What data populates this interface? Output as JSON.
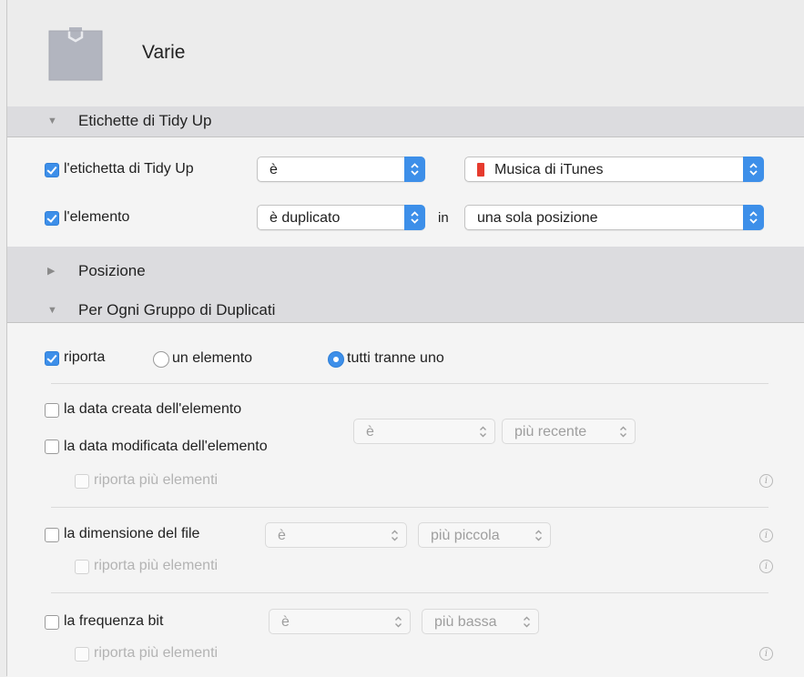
{
  "header": {
    "title": "Varie",
    "icon": "folder-icon"
  },
  "sections": {
    "tags": {
      "label": "Etichette di Tidy Up",
      "expanded": true
    },
    "position": {
      "label": "Posizione",
      "expanded": false
    },
    "per_group": {
      "label": "Per Ogni Gruppo di Duplicati",
      "expanded": true
    }
  },
  "tags_panel": {
    "row1": {
      "checked": true,
      "label": "l'etichetta di Tidy Up",
      "operator": "è",
      "value": "Musica di iTunes",
      "value_color": "#e63b2e"
    },
    "row2": {
      "checked": true,
      "label": "l'elemento",
      "operator": "è duplicato",
      "in_label": "in",
      "value": "una sola posizione"
    }
  },
  "group_panel": {
    "report": {
      "checked": true,
      "label": "riporta",
      "options": [
        "un elemento",
        "tutti tranne uno"
      ],
      "selected": "tutti tranne uno"
    },
    "date_block": {
      "created_label": "la data creata dell'elemento",
      "modified_label": "la data modificata dell'elemento",
      "operator": "è",
      "value": "più recente",
      "report_more": "riporta più elementi"
    },
    "size_block": {
      "label": "la dimensione del file",
      "operator": "è",
      "value": "più piccola",
      "report_more": "riporta più elementi"
    },
    "bitrate_block": {
      "label": "la frequenza bit",
      "operator": "è",
      "value": "più bassa",
      "report_more": "riporta più elementi"
    },
    "info_glyph": "i"
  },
  "colors": {
    "accent": "#3d8fe9",
    "section_bar": "#dcdcdf",
    "panel": "#f4f4f4"
  }
}
